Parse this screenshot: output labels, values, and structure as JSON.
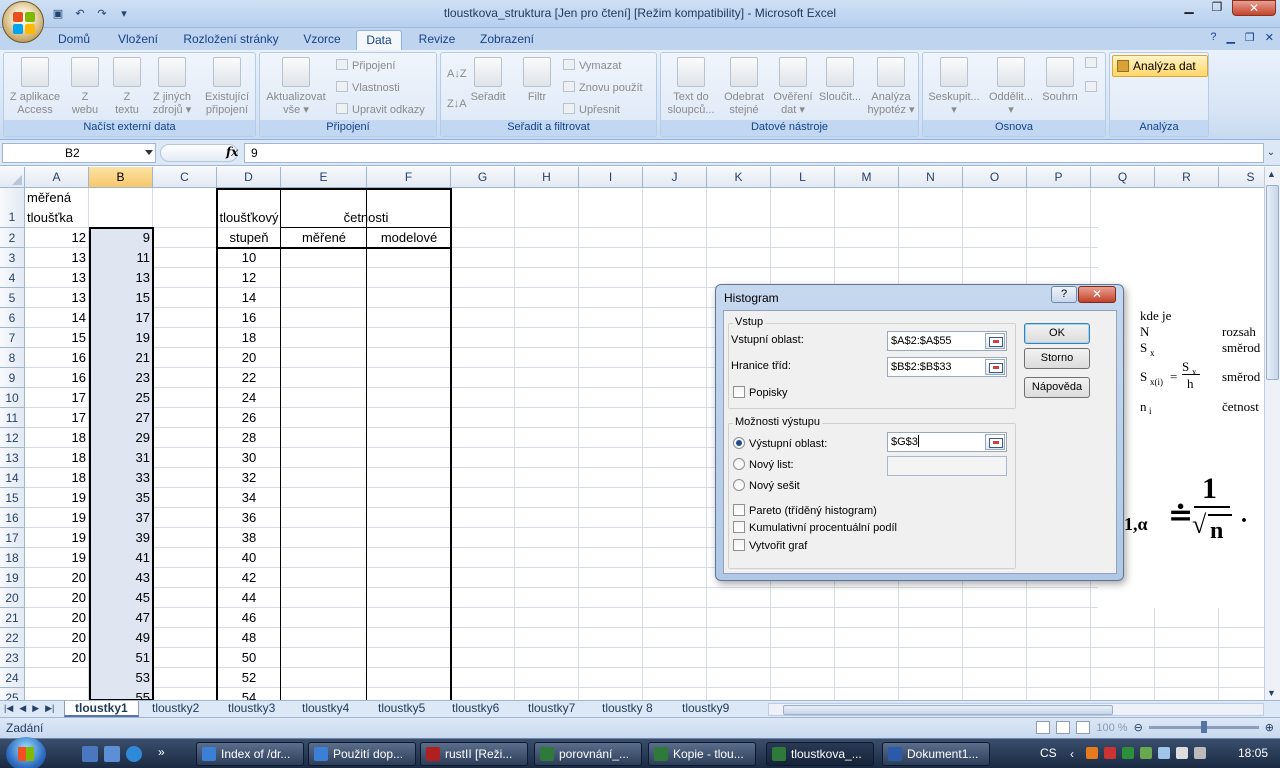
{
  "window": {
    "title": "tloustkova_struktura  [Jen pro čtení]  [Režim kompatibility] - Microsoft Excel"
  },
  "ribbon": {
    "tabs": [
      "Domů",
      "Vložení",
      "Rozložení stránky",
      "Vzorce",
      "Data",
      "Revize",
      "Zobrazení"
    ],
    "active_tab": "Data",
    "groups": {
      "external": {
        "label": "Načíst externí data",
        "buttons": [
          "Z aplikace\nAccess",
          "Z\nwebu",
          "Z\ntextu",
          "Z jiných\nzdrojů ▾",
          "Existující\npřipojení"
        ]
      },
      "connections": {
        "label": "Připojení",
        "refresh": "Aktualizovat\nvše ▾",
        "items": [
          "Připojení",
          "Vlastnosti",
          "Upravit odkazy"
        ]
      },
      "sort": {
        "label": "Seřadit a filtrovat",
        "sort": "Seřadit",
        "filter": "Filtr",
        "items": [
          "Vymazat",
          "Znovu použít",
          "Upřesnit"
        ]
      },
      "tools": {
        "label": "Datové nástroje",
        "buttons": [
          "Text do\nsloupců...",
          "Odebrat\nstejné",
          "Ověření\ndat ▾",
          "Sloučit...",
          "Analýza\nhypotéz ▾"
        ]
      },
      "outline": {
        "label": "Osnova",
        "buttons": [
          "Seskupit...\n▾",
          "Oddělit...\n▾",
          "Souhrn"
        ]
      },
      "analysis": {
        "label": "Analýza",
        "button": "Analýza dat"
      }
    }
  },
  "formula_bar": {
    "name_box": "B2",
    "fx": "fx",
    "value": "9"
  },
  "grid": {
    "columns": [
      "A",
      "B",
      "C",
      "D",
      "E",
      "F",
      "G",
      "H",
      "I",
      "J",
      "K",
      "L",
      "M",
      "N",
      "O",
      "P",
      "Q",
      "R",
      "S"
    ],
    "selected_column": "B",
    "rows": [
      "1",
      "2",
      "3",
      "4",
      "5",
      "6",
      "7",
      "8",
      "9",
      "10",
      "11",
      "12",
      "13",
      "14",
      "15",
      "16",
      "17",
      "18",
      "19",
      "20",
      "21",
      "22",
      "23",
      "24",
      "25"
    ],
    "headers": {
      "a1_line1": "měřená",
      "a1_line2": "tloušťka",
      "d_line1": "tloušťkový",
      "d_line2": "stupeň",
      "ef": "četnosti",
      "e": "měřené",
      "f": "modelové"
    },
    "col_a": [
      "12",
      "13",
      "13",
      "13",
      "14",
      "15",
      "16",
      "16",
      "17",
      "17",
      "18",
      "18",
      "18",
      "19",
      "19",
      "19",
      "19",
      "20",
      "20",
      "20",
      "20",
      "20"
    ],
    "col_b": [
      "9",
      "11",
      "13",
      "15",
      "17",
      "19",
      "21",
      "23",
      "25",
      "27",
      "29",
      "31",
      "33",
      "35",
      "37",
      "39",
      "41",
      "43",
      "45",
      "47",
      "49",
      "51",
      "53",
      "55"
    ],
    "col_d": [
      "10",
      "12",
      "14",
      "16",
      "18",
      "20",
      "22",
      "24",
      "26",
      "28",
      "30",
      "32",
      "34",
      "36",
      "38",
      "40",
      "42",
      "44",
      "46",
      "48",
      "50",
      "52",
      "54"
    ]
  },
  "picture": {
    "kde_je": "kde je",
    "n": "N",
    "rozsah": "rozsah",
    "sx": "S",
    "sx_sub": "x",
    "smerod1": "směrod",
    "sxi": "S",
    "sxi_sub": "x(i)",
    "eq": "=",
    "frac_num": "S",
    "frac_num_sub": "x",
    "frac_den": "h",
    "smerod2": "směrod",
    "ni": "n",
    "ni_sub": "i",
    "cetnost": "četnost",
    "formula_left": "1,α",
    "approx": "≐",
    "one": "1",
    "sqrt_n": "n",
    "dot": "·"
  },
  "dialog": {
    "title": "Histogram",
    "help": "?",
    "close": "✕",
    "input_legend": "Vstup",
    "input_range_label": "Vstupní oblast:",
    "input_range_value": "$A$2:$A$55",
    "bin_range_label": "Hranice tříd:",
    "bin_range_value": "$B$2:$B$33",
    "labels_label": "Popisky",
    "output_legend": "Možnosti výstupu",
    "output_range_label": "Výstupní oblast:",
    "output_range_value": "$G$3",
    "new_sheet_label": "Nový list:",
    "new_workbook_label": "Nový sešit",
    "pareto_label": "Pareto (tříděný histogram)",
    "cumulative_label": "Kumulativní procentuální podíl",
    "chart_label": "Vytvořit graf",
    "ok": "OK",
    "cancel": "Storno",
    "help_btn": "Nápověda"
  },
  "sheets": [
    "tloustky1",
    "tloustky2",
    "tloustky3",
    "tloustky4",
    "tloustky5",
    "tloustky6",
    "tloustky7",
    "tloustky 8",
    "tloustky9"
  ],
  "active_sheet": "tloustky1",
  "status": {
    "mode": "Zadání",
    "zoom": "100 %"
  },
  "taskbar": {
    "buttons": [
      "Index of /dr...",
      "Použití dop...",
      "rustII [Reži...",
      "porovnání_...",
      "Kopie - tlou...",
      "tloustkova_...",
      "Dokument1..."
    ],
    "active": "tloustkova_...",
    "lang": "CS",
    "clock": "18:05"
  }
}
